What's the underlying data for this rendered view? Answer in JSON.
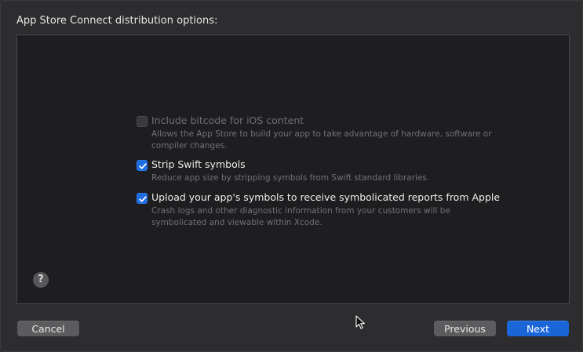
{
  "dialog": {
    "heading": "App Store Connect distribution options:"
  },
  "options": [
    {
      "title": "Include bitcode for iOS content",
      "description": "Allows the App Store to build your app to take advantage of hardware, software or compiler changes.",
      "checked": false,
      "enabled": false
    },
    {
      "title": "Strip Swift symbols",
      "description": "Reduce app size by stripping symbols from Swift standard libraries.",
      "checked": true,
      "enabled": true
    },
    {
      "title": "Upload your app's symbols to receive symbolicated reports from Apple",
      "description": "Crash logs and other diagnostic information from your customers will be symbolicated and viewable within Xcode.",
      "checked": true,
      "enabled": true
    }
  ],
  "help": {
    "label": "?"
  },
  "buttons": {
    "cancel": "Cancel",
    "previous": "Previous",
    "next": "Next"
  },
  "colors": {
    "accent": "#1a66d9",
    "panel_bg": "#1e1e20",
    "window_bg": "#2d2d2f"
  }
}
